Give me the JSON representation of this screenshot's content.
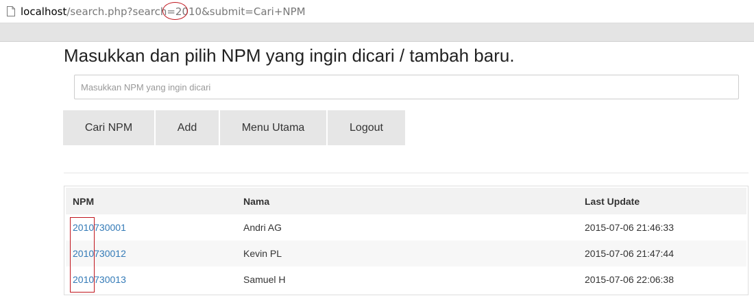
{
  "browser": {
    "url_host": "localhost",
    "url_rest": "/search.php?search=2010&submit=Cari+NPM"
  },
  "page": {
    "title": "Masukkan dan pilih NPM yang ingin dicari / tambah baru.",
    "search_placeholder": "Masukkan NPM yang ingin dicari",
    "search_value": ""
  },
  "buttons": {
    "search": "Cari NPM",
    "add": "Add",
    "menu": "Menu Utama",
    "logout": "Logout"
  },
  "table": {
    "headers": [
      "NPM",
      "Nama",
      "Last Update"
    ],
    "rows": [
      {
        "npm": "2010730001",
        "nama": "Andri AG",
        "last_update": "2015-07-06 21:46:33"
      },
      {
        "npm": "2010730012",
        "nama": "Kevin PL",
        "last_update": "2015-07-06 21:47:44"
      },
      {
        "npm": "2010730013",
        "nama": "Samuel H",
        "last_update": "2015-07-06 22:06:38"
      }
    ]
  },
  "colors": {
    "link": "#337ab7",
    "annotation": "#c0141c",
    "button_bg": "#e6e6e6"
  },
  "icons": {
    "page": "page-icon"
  }
}
